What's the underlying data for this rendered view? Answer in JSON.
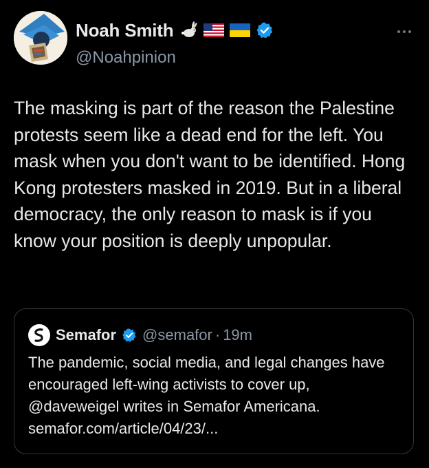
{
  "author": {
    "display_name": "Noah Smith",
    "handle": "@Noahpinion",
    "avatar_icon": "noahpinion-avatar-icon",
    "badges": [
      "rabbit-emoji-icon",
      "us-flag-icon",
      "ukraine-flag-icon",
      "verified-badge-icon"
    ]
  },
  "more_button": {
    "icon": "more-horizontal-icon"
  },
  "tweet": {
    "text": "The masking is part of the reason the Palestine protests seem like a dead end for the left. You mask when you don't want to be identified. Hong Kong protesters masked in 2019. But in a liberal democracy, the only reason to mask is if you know your position is deeply unpopular."
  },
  "quote": {
    "display_name": "Semafor",
    "handle": "@semafor",
    "separator": "·",
    "time": "19m",
    "text": "The pandemic, social media, and legal changes have encouraged left-wing activists to cover up, @daveweigel writes in Semafor Americana.",
    "link": "semafor.com/article/04/23/..."
  },
  "colors": {
    "background": "#000000",
    "text": "#e7e9ea",
    "secondary_text": "#8b98a5",
    "verified_blue": "#1d9bf0",
    "border": "#333639"
  }
}
